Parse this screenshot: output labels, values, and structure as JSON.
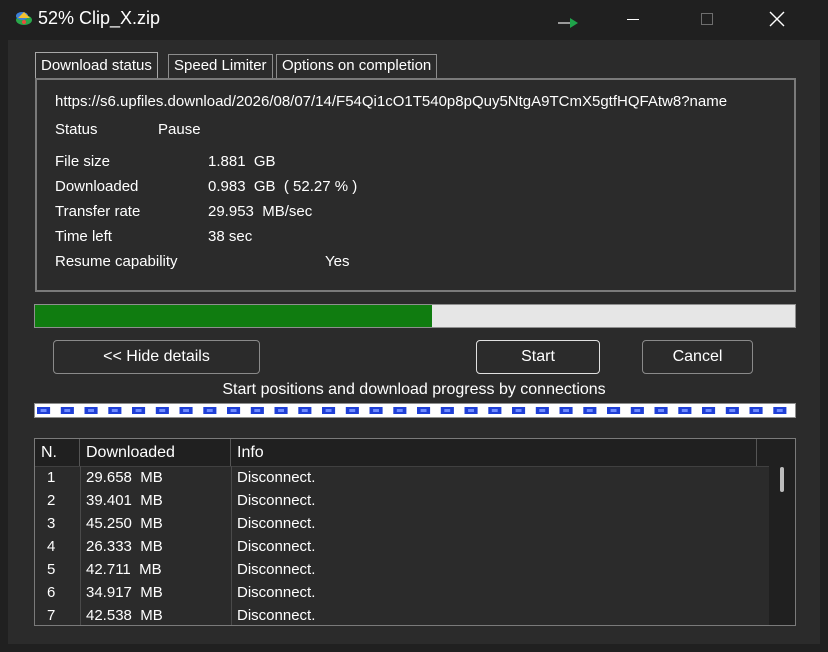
{
  "window": {
    "title": "52% Clip_X.zip"
  },
  "tabs": [
    {
      "label": "Download status",
      "active": true
    },
    {
      "label": "Speed Limiter",
      "active": false
    },
    {
      "label": "Options on completion",
      "active": false
    }
  ],
  "status": {
    "url": "https://s6.upfiles.download/2026/08/07/14/F54Qi1cO1T540p8pQuy5NtgA9TCmX5gtfHQFAtw8?name",
    "status_label": "Status",
    "status_value": "Pause",
    "file_size_label": "File size",
    "file_size_value": "1.881  GB",
    "downloaded_label": "Downloaded",
    "downloaded_value": "0.983  GB  ( 52.27 % )",
    "transfer_rate_label": "Transfer rate",
    "transfer_rate_value": "29.953  MB/sec",
    "time_left_label": "Time left",
    "time_left_value": "38 sec",
    "resume_label": "Resume capability",
    "resume_value": "Yes"
  },
  "progress": {
    "fraction": 0.5227,
    "fill_color": "#107c10"
  },
  "buttons": {
    "hide_details": "<< Hide details",
    "start": "Start",
    "cancel": "Cancel"
  },
  "connections": {
    "caption": "Start positions and download progress by connections",
    "segment_color": "#1f3fd6",
    "segment_count": 32
  },
  "table": {
    "headers": [
      "N.",
      "Downloaded",
      "Info"
    ],
    "rows": [
      {
        "n": "1",
        "downloaded": "29.658  MB",
        "info": "Disconnect."
      },
      {
        "n": "2",
        "downloaded": "39.401  MB",
        "info": "Disconnect."
      },
      {
        "n": "3",
        "downloaded": "45.250  MB",
        "info": "Disconnect."
      },
      {
        "n": "4",
        "downloaded": "26.333  MB",
        "info": "Disconnect."
      },
      {
        "n": "5",
        "downloaded": "42.711  MB",
        "info": "Disconnect."
      },
      {
        "n": "6",
        "downloaded": "34.917  MB",
        "info": "Disconnect."
      },
      {
        "n": "7",
        "downloaded": "42.538  MB",
        "info": "Disconnect."
      }
    ]
  }
}
